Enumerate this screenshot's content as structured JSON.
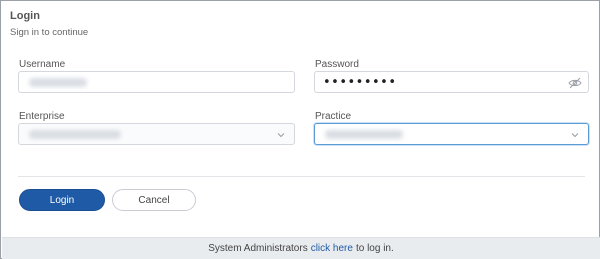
{
  "header": {
    "title": "Login",
    "subtitle": "Sign in to continue"
  },
  "form": {
    "username": {
      "label": "Username",
      "value": ""
    },
    "password": {
      "label": "Password",
      "masked_value": "•••••••••"
    },
    "enterprise": {
      "label": "Enterprise",
      "selected": ""
    },
    "practice": {
      "label": "Practice",
      "selected": ""
    }
  },
  "actions": {
    "login_label": "Login",
    "cancel_label": "Cancel"
  },
  "footer": {
    "text_before": "System Administrators",
    "link_text": "click here",
    "text_after": "to log in."
  },
  "colors": {
    "primary": "#1f5aa6",
    "footer_bg": "#e9ecef",
    "focus_border": "#5b9bd5"
  },
  "icons": {
    "password_toggle": "eye-slash-icon",
    "dropdown": "chevron-down-icon"
  }
}
